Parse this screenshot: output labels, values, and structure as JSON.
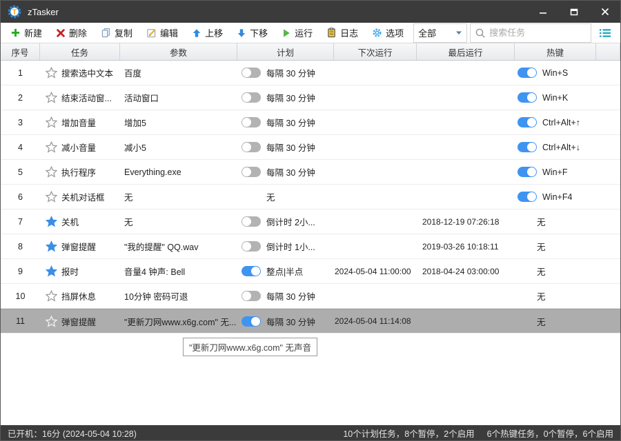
{
  "window": {
    "title": "zTasker"
  },
  "titlebar": {
    "controls": {
      "minimize": "minimize",
      "maximize": "maximize",
      "close": "close"
    }
  },
  "toolbar": {
    "buttons": [
      {
        "label": "新建",
        "icon": "plus-icon"
      },
      {
        "label": "删除",
        "icon": "delete-icon"
      },
      {
        "label": "复制",
        "icon": "copy-icon"
      },
      {
        "label": "编辑",
        "icon": "edit-icon"
      },
      {
        "label": "上移",
        "icon": "arrow-up-icon"
      },
      {
        "label": "下移",
        "icon": "arrow-down-icon"
      },
      {
        "label": "运行",
        "icon": "play-icon"
      },
      {
        "label": "日志",
        "icon": "log-icon"
      },
      {
        "label": "选项",
        "icon": "gear-icon"
      }
    ],
    "filter": {
      "value": "全部"
    },
    "search": {
      "placeholder": "搜索任务"
    }
  },
  "table": {
    "columns": [
      {
        "label": "序号"
      },
      {
        "label": "任务"
      },
      {
        "label": "参数"
      },
      {
        "label": "计划"
      },
      {
        "label": "下次运行"
      },
      {
        "label": "最后运行"
      },
      {
        "label": "热键"
      }
    ],
    "rows": [
      {
        "num": "1",
        "starred": false,
        "task": "搜索选中文本",
        "param": "百度",
        "schedule": {
          "toggle": "off",
          "text": "每隔 30 分钟"
        },
        "next_run": "",
        "last_run": "",
        "hotkey": {
          "toggle": "on",
          "text": "Win+S"
        },
        "selected": false
      },
      {
        "num": "2",
        "starred": false,
        "task": "结束活动窗...",
        "param": "活动窗口",
        "schedule": {
          "toggle": "off",
          "text": "每隔 30 分钟"
        },
        "next_run": "",
        "last_run": "",
        "hotkey": {
          "toggle": "on",
          "text": "Win+K"
        },
        "selected": false
      },
      {
        "num": "3",
        "starred": false,
        "task": "增加音量",
        "param": "增加5",
        "schedule": {
          "toggle": "off",
          "text": "每隔 30 分钟"
        },
        "next_run": "",
        "last_run": "",
        "hotkey": {
          "toggle": "on",
          "text": "Ctrl+Alt+↑"
        },
        "selected": false
      },
      {
        "num": "4",
        "starred": false,
        "task": "减小音量",
        "param": "减小5",
        "schedule": {
          "toggle": "off",
          "text": "每隔 30 分钟"
        },
        "next_run": "",
        "last_run": "",
        "hotkey": {
          "toggle": "on",
          "text": "Ctrl+Alt+↓"
        },
        "selected": false
      },
      {
        "num": "5",
        "starred": false,
        "task": "执行程序",
        "param": "Everything.exe",
        "schedule": {
          "toggle": "off",
          "text": "每隔 30 分钟"
        },
        "next_run": "",
        "last_run": "",
        "hotkey": {
          "toggle": "on",
          "text": "Win+F"
        },
        "selected": false
      },
      {
        "num": "6",
        "starred": false,
        "task": "关机对话框",
        "param": "无",
        "schedule": {
          "toggle": "none",
          "text": "无"
        },
        "next_run": "",
        "last_run": "",
        "hotkey": {
          "toggle": "on",
          "text": "Win+F4"
        },
        "selected": false
      },
      {
        "num": "7",
        "starred": true,
        "task": "关机",
        "param": "无",
        "schedule": {
          "toggle": "off",
          "text": "倒计时 2小..."
        },
        "next_run": "",
        "last_run": "2018-12-19 07:26:18",
        "hotkey": {
          "toggle": "none",
          "text": "无"
        },
        "selected": false
      },
      {
        "num": "8",
        "starred": true,
        "task": "弹窗提醒",
        "param": "\"我的提醒\" QQ.wav",
        "schedule": {
          "toggle": "off",
          "text": "倒计时 1小..."
        },
        "next_run": "",
        "last_run": "2019-03-26 10:18:11",
        "hotkey": {
          "toggle": "none",
          "text": "无"
        },
        "selected": false
      },
      {
        "num": "9",
        "starred": true,
        "task": "报时",
        "param": "音量4 钟声: Bell",
        "schedule": {
          "toggle": "on",
          "text": "整点|半点"
        },
        "next_run": "2024-05-04 11:00:00",
        "last_run": "2018-04-24 03:00:00",
        "hotkey": {
          "toggle": "none",
          "text": "无"
        },
        "selected": false
      },
      {
        "num": "10",
        "starred": false,
        "task": "挡屏休息",
        "param": "10分钟 密码可退",
        "schedule": {
          "toggle": "off",
          "text": "每隔 30 分钟"
        },
        "next_run": "",
        "last_run": "",
        "hotkey": {
          "toggle": "none",
          "text": "无"
        },
        "selected": false
      },
      {
        "num": "11",
        "starred": false,
        "task": "弹窗提醒",
        "param": "\"更新刀网www.x6g.com\" 无...",
        "schedule": {
          "toggle": "on",
          "text": "每隔 30 分钟"
        },
        "next_run": "2024-05-04 11:14:08",
        "last_run": "",
        "hotkey": {
          "toggle": "none",
          "text": "无"
        },
        "selected": true
      }
    ]
  },
  "tooltip": {
    "text": "\"更新刀网www.x6g.com\" 无声音"
  },
  "statusbar": {
    "left": "已开机：16分 (2024-05-04 10:28)",
    "plan_summary": "10个计划任务，8个暂停，2个启用",
    "hotkey_summary": "6个热键任务，0个暂停，6个启用"
  },
  "colors": {
    "titlebar_bg": "#3b3b3b",
    "accent_blue": "#3f94f2",
    "star_blue": "#3a8ee6",
    "teal": "#1ca6bc",
    "green": "#22a022",
    "red": "#cc2222",
    "selected_row": "#adadad",
    "toggle_off": "#b3b3b3"
  }
}
